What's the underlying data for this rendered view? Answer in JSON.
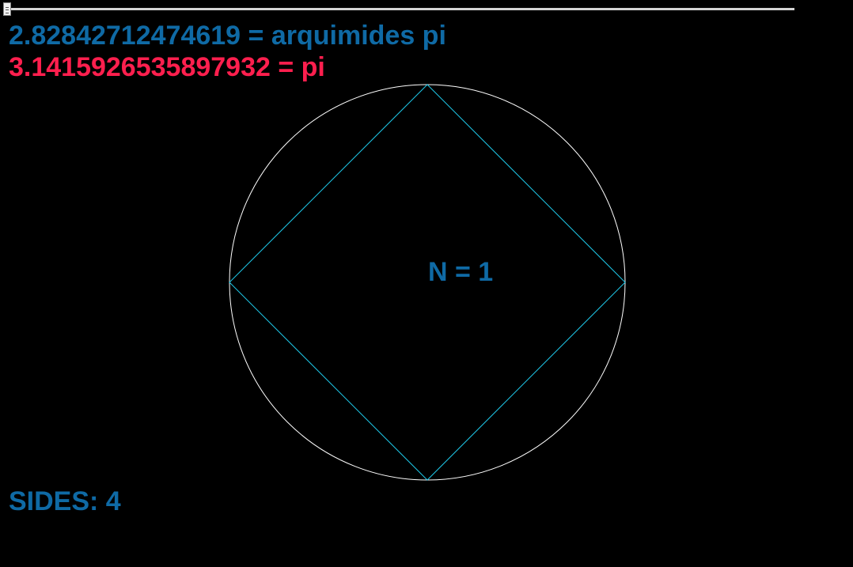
{
  "colors": {
    "background": "#000000",
    "approx_text": "#0f6aa5",
    "pi_text": "#ff1f4e",
    "circle_stroke": "#ffffff",
    "polygon_stroke": "#1ec8e8",
    "n_text": "#0f6aa5",
    "sides_text": "#0f6aa5"
  },
  "slider": {
    "value_fraction": 0
  },
  "archimedes": {
    "value": "2.82842712474619",
    "suffix": " = arquimides pi"
  },
  "pi": {
    "value": "3.1415926535897932",
    "suffix": " = pi"
  },
  "iteration": {
    "label": "N = 1"
  },
  "sides": {
    "label": "SIDES: 4",
    "count": 4
  }
}
